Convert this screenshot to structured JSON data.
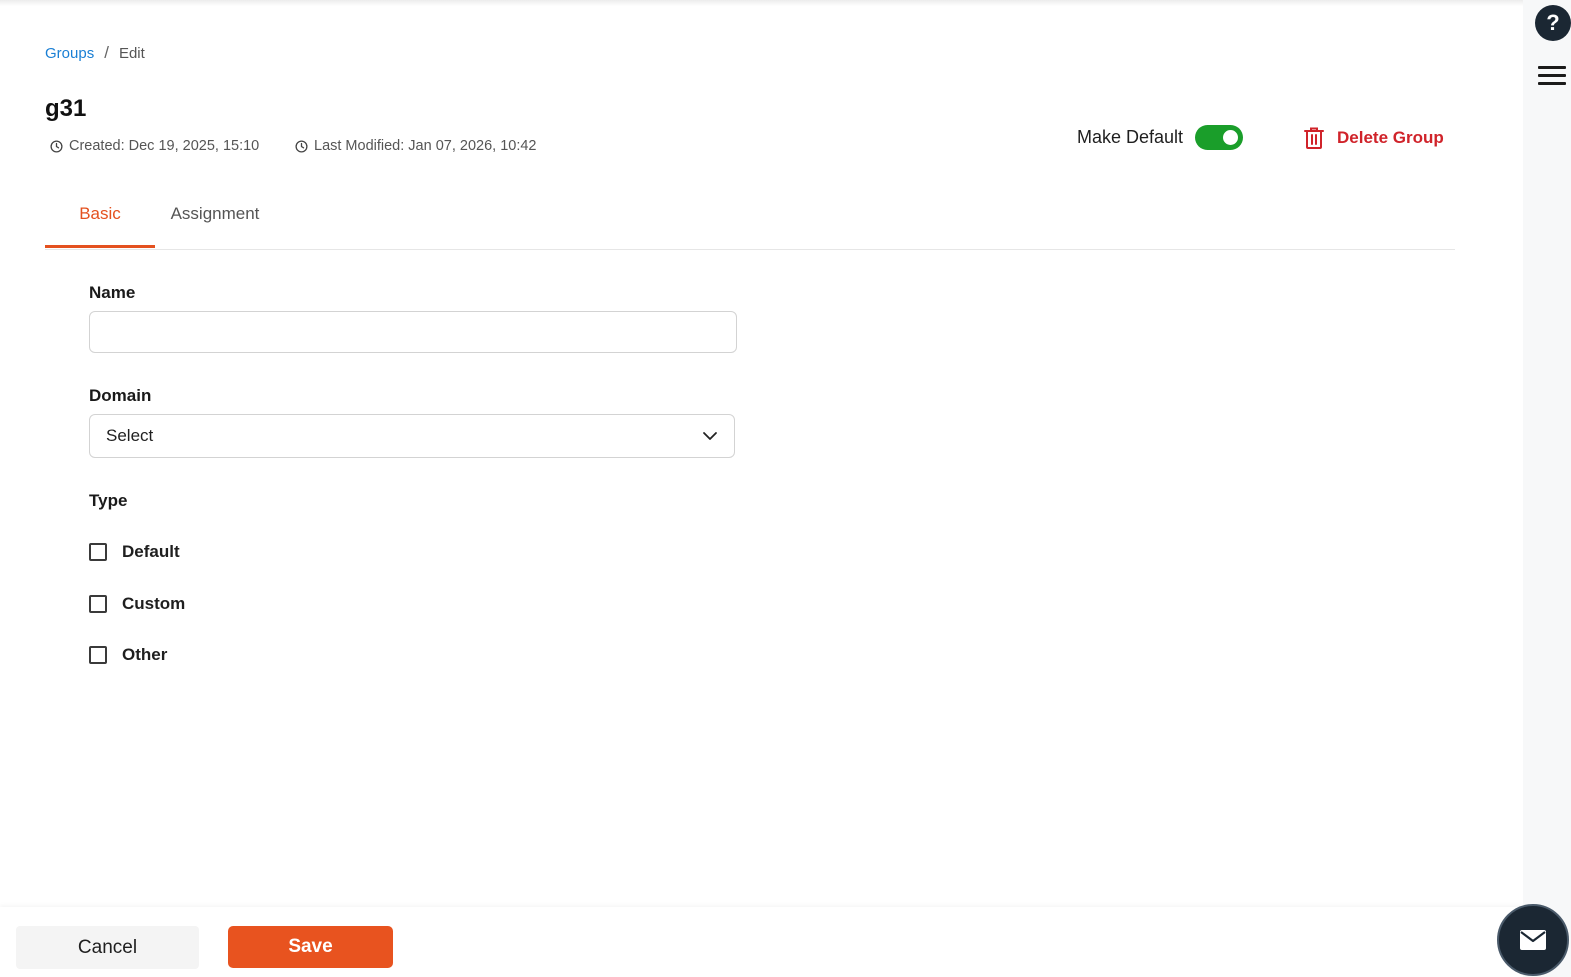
{
  "breadcrumb": {
    "parent": "Groups",
    "separator": "/",
    "current": "Edit"
  },
  "group": {
    "title": "g31",
    "created": "Created: Dec 19, 2025, 15:10",
    "modified": "Last Modified: Jan 07, 2026, 10:42"
  },
  "actions": {
    "make_default_label": "Make Default",
    "make_default_on": true,
    "delete_label": "Delete Group"
  },
  "tabs": [
    {
      "label": "Basic",
      "active": true
    },
    {
      "label": "Assignment",
      "active": false
    }
  ],
  "form": {
    "name_label": "Name",
    "name_value": "",
    "domain_label": "Domain",
    "domain_value": "Select",
    "type_label": "Type",
    "type_options": [
      {
        "label": "Default",
        "checked": false
      },
      {
        "label": "Custom",
        "checked": false
      },
      {
        "label": "Other",
        "checked": false
      }
    ]
  },
  "footer": {
    "cancel_label": "Cancel",
    "save_label": "Save"
  },
  "rail": {
    "help_label": "?"
  },
  "icons": [
    "clock-icon",
    "trash-icon",
    "chevron-down-icon",
    "help-icon",
    "hamburger-menu-icon",
    "mail-icon"
  ],
  "colors": {
    "accent": "#e8531f",
    "link": "#1a7fd4",
    "danger": "#d0232a",
    "toggle_on": "#1a9e2a",
    "dark": "#1b2733"
  }
}
